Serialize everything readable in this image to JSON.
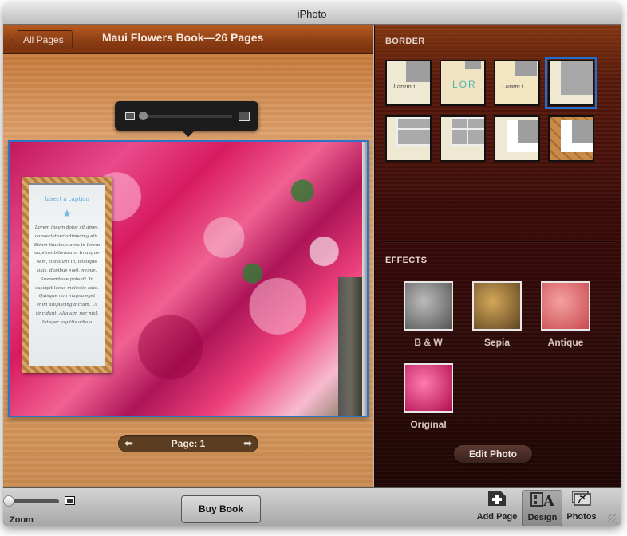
{
  "window": {
    "title": "iPhoto"
  },
  "header": {
    "back_label": "All Pages",
    "book_title": "Maui Flowers Book—26 Pages"
  },
  "zoom_popover": {
    "small_icon": "photo-small-icon",
    "large_icon": "photo-large-icon",
    "value_fraction": 0.0
  },
  "caption_card": {
    "title": "Insert a caption",
    "star_icon": "★",
    "body": "Lorem ipsum dolor sit amet, consectetuer adipiscing elit. Etiam faucibus arcu in lorem dapibus bibendum. In augue sem, tincidunt in, tristique quis, dapibus eget, neque. Suspendisse potenti. In suscipit lacus molestie odio. Quisque non magna eget enim adipiscing dictum. Ut tincidunt. Aliquam nec nisl. Integer sagittis odio a"
  },
  "page_nav": {
    "prev_icon": "⬅",
    "label": "Page: 1",
    "next_icon": "➡"
  },
  "right_panel": {
    "border_label": "BORDER",
    "borders": [
      {
        "name": "border-cream-caption",
        "text": "Lorem i",
        "selected": false
      },
      {
        "name": "border-torn-paper",
        "text": "LOR",
        "selected": false
      },
      {
        "name": "border-cream-frame",
        "text": "Lorem i",
        "selected": false
      },
      {
        "name": "border-plain-cream",
        "text": "",
        "selected": true
      },
      {
        "name": "border-window-2",
        "text": "",
        "selected": false
      },
      {
        "name": "border-window-4",
        "text": "",
        "selected": false
      },
      {
        "name": "border-white-mat",
        "text": "",
        "selected": false
      },
      {
        "name": "border-wood-mat",
        "text": "",
        "selected": false
      }
    ],
    "effects_label": "EFFECTS",
    "effects": [
      {
        "label": "B & W",
        "color": "#7a7a7a"
      },
      {
        "label": "Sepia",
        "color": "#9c7a3a"
      },
      {
        "label": "Antique",
        "color": "#e06870"
      },
      {
        "label": "Original",
        "color": "#e0307a"
      }
    ],
    "edit_photo_label": "Edit Photo"
  },
  "toolbar": {
    "zoom_label": "Zoom",
    "zoom_value_fraction": 0.0,
    "buy_book_label": "Buy Book",
    "tools": [
      {
        "label": "Add Page",
        "icon": "add-page-icon",
        "active": false
      },
      {
        "label": "Design",
        "icon": "design-icon",
        "active": true
      },
      {
        "label": "Photos",
        "icon": "photos-icon",
        "active": false
      }
    ]
  },
  "colors": {
    "selection_blue": "#2d73c8",
    "wood_header": "#8a3c12",
    "panel_dark": "#2d0a08"
  }
}
